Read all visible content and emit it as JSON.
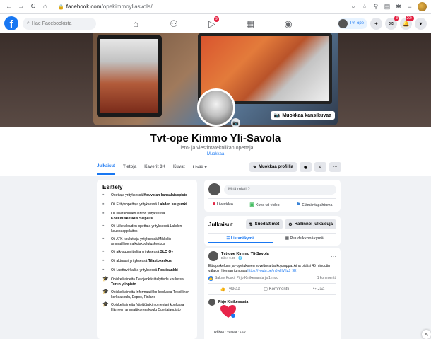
{
  "browser": {
    "url_host": "facebook.com",
    "url_path": "/opekimmoyliasvola/"
  },
  "fb": {
    "logo": "f",
    "search_placeholder": "Hae Facebookista",
    "user_name": "Tvt-ope",
    "video_badge": "9",
    "messenger_badge": "3",
    "notif_badge": "20+"
  },
  "cover": {
    "edit_cover_label": "Muokkaa kansikuvaa"
  },
  "page": {
    "name": "Tvt-ope Kimmo Yli-Savola",
    "category": "Tieto- ja viestintätekniikan opettaja",
    "edit_label": "Muokkaa"
  },
  "tabs": [
    {
      "label": "Julkaisut",
      "active": true
    },
    {
      "label": "Tietoja",
      "active": false
    },
    {
      "label": "Kaverit 3K",
      "active": false
    },
    {
      "label": "Kuvat",
      "active": false
    },
    {
      "label": "Lisää ▾",
      "active": false
    }
  ],
  "actions": {
    "edit_profile": "Muokkaa profiilia"
  },
  "intro": {
    "title": "Esittely",
    "items": [
      {
        "pre": "Opettaja yrityksessä ",
        "bold": "Kouvolan kansalaisopisto"
      },
      {
        "pre": "Oli Erityisopettaja yrityksessä ",
        "bold": "Lahden kaupunki"
      },
      {
        "pre": "Oli liiketalouden lehtori yrityksessä ",
        "bold": "Koulutuskeskus Salpaus"
      },
      {
        "pre": "Oli Liiketalouden opettaja yrityksessä ",
        "bold": "",
        "post": "Lahden kauppaoppilaitos"
      },
      {
        "pre": "Oli ATK-kouluttaja yrityksessä Mikkelin ammatillinen aikuiskoulutuskeskus",
        "bold": ""
      },
      {
        "pre": "Oli atk-suunnittelija yrityksessä ",
        "bold": "SLO Oy"
      },
      {
        "pre": "Oli aktuaari yrityksessä ",
        "bold": "Tilastokeskus"
      },
      {
        "pre": "Oli Luottovirkailija yrityksessä ",
        "bold": "Postipankki"
      },
      {
        "pre": "Opiskeli aineita Tietojenkäsittelytiede koulussa ",
        "bold": "Turun yliopisto"
      },
      {
        "pre": "Opiskeli aineita Informaatikko koulussa Teknillinen korkeakoulu, Espoo, Finland",
        "bold": ""
      },
      {
        "pre": "Opiskeli aineita Näyttötutkintomestari koulussa Hämeen ammattikorkeakoulu Opettajaopisto",
        "bold": ""
      }
    ]
  },
  "composer": {
    "placeholder": "Mitä mietit?",
    "live": "Livevideo",
    "photo": "Kuva tai video",
    "life_event": "Elämäntapahtuma"
  },
  "posts": {
    "title": "Julkaisut",
    "filters": "Suodattimet",
    "manage": "Hallinnoi julkaisuja",
    "list_view": "Listanäkymä",
    "grid_view": "Ruudukkonäkymä"
  },
  "post": {
    "author": "Tvt-ope Kimmo Yli-Savola",
    "time": "Eilen 9.35 · 🌐",
    "text": "Etäopiskeluun ja -opetukseen soveltuva taukojumppa. Aina pitäisi 45 minuutin välajoin hieman jumpata ",
    "link": "https://youtu.be/in5wHVjIzJ_9E",
    "likes": "Sakne Koski, Pirjo Kinikemanta ja 1 muu",
    "comments": "1 kommentti",
    "like_btn": "Tykkää",
    "comment_btn": "Kommentti",
    "share_btn": "Jaa",
    "commenter": "Pirjo Kinikemanta",
    "comment_meta_like": "Tykkää",
    "comment_meta_reply": "Vastaa",
    "comment_meta_time": "1 pv"
  },
  "colors": {
    "fb_blue": "#1877f2",
    "badge_red": "#e41e3f"
  }
}
